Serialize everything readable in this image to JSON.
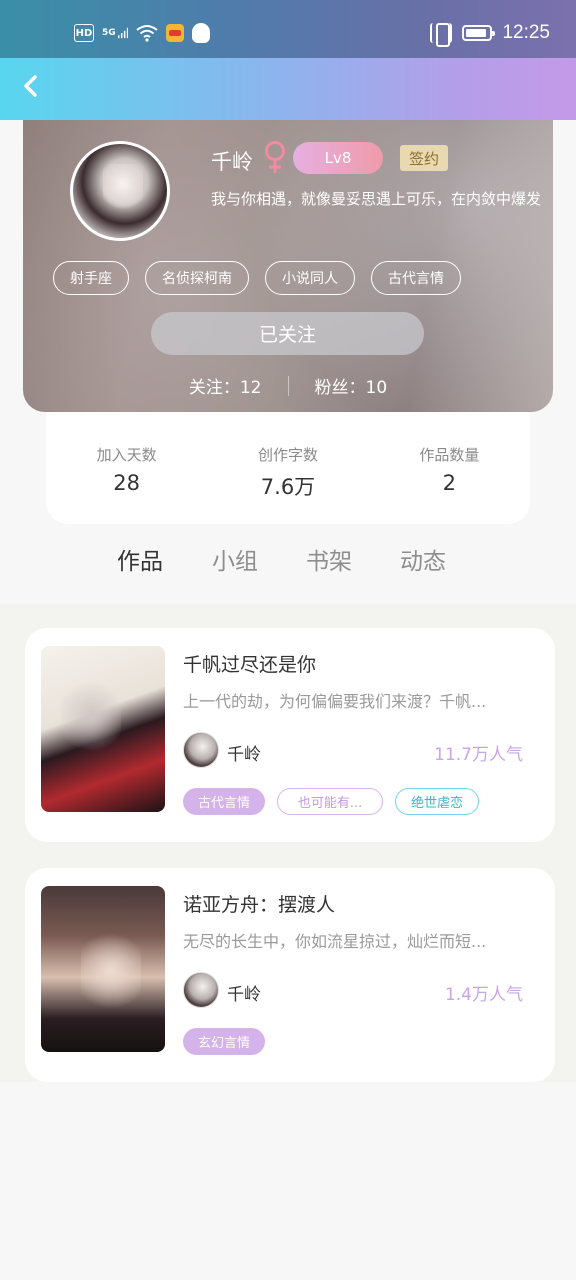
{
  "status_bar": {
    "hd_label": "HD",
    "signal_label": "5G",
    "time": "12:25"
  },
  "header": {
    "back_icon": "chevron-left-icon"
  },
  "profile": {
    "name": "千岭",
    "gender_icon": "female-icon",
    "level": "Lv8",
    "sign_label": "签约",
    "bio": "我与你相遇，就像曼妥思遇上可乐，在内敛中爆发",
    "tags": [
      "射手座",
      "名侦探柯南",
      "小说同人",
      "古代言情"
    ],
    "follow_button": "已关注",
    "following_label": "关注：12",
    "followers_label": "粉丝：10"
  },
  "stats": [
    {
      "label": "加入天数",
      "value": "28"
    },
    {
      "label": "创作字数",
      "value": "7.6万"
    },
    {
      "label": "作品数量",
      "value": "2"
    }
  ],
  "tabs": [
    {
      "label": "作品",
      "active": true
    },
    {
      "label": "小组",
      "active": false
    },
    {
      "label": "书架",
      "active": false
    },
    {
      "label": "动态",
      "active": false
    }
  ],
  "works": [
    {
      "title": "千帆过尽还是你",
      "desc": "上一代的劫，为何偏偏要我们来渡？千帆...",
      "author": "千岭",
      "popularity": "11.7万人气",
      "tags": [
        "古代言情",
        "也可能有...",
        "绝世虐恋"
      ]
    },
    {
      "title": "诺亚方舟：摆渡人",
      "desc": "无尽的长生中，你如流星掠过，灿烂而短...",
      "author": "千岭",
      "popularity": "1.4万人气",
      "tags": [
        "玄幻言情"
      ]
    }
  ],
  "colors": {
    "accent": "#c9a9ea",
    "popularity": "#c8a5e8",
    "header_start": "#58d6ef",
    "header_end": "#c39ae8"
  }
}
